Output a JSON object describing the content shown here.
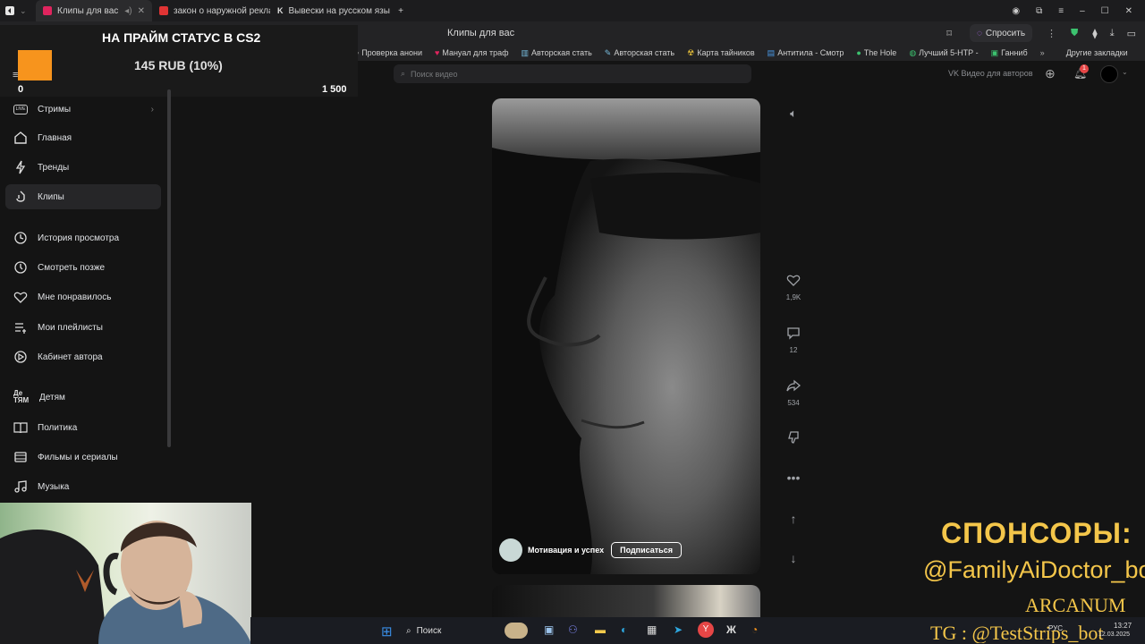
{
  "browser": {
    "tabs": [
      {
        "label": "Клипы для вас",
        "active": true,
        "color": "#e0245e"
      },
      {
        "label": "закон о наружной реклам",
        "active": false,
        "color": "#e03434"
      },
      {
        "label": "Вывески на русском язы",
        "active": false,
        "color": "#cccccc"
      }
    ],
    "address_title": "Клипы для вас",
    "ask_label": "Спросить",
    "bookmarks": [
      "Проверка анони",
      "Мануал для траф",
      "Авторская стать",
      "Авторская стать",
      "Карта тайников",
      "Антитила - Смотр",
      "The Hole",
      "Лучший 5-НТР -",
      "Ганниб"
    ],
    "other_bookmarks": "Другие закладки"
  },
  "promo": {
    "title": "НА ПРАЙМ СТАТУС В CS2",
    "price": "145 RUB (10%)",
    "progress_min": "0",
    "progress_max": "1 500",
    "url_fragment": "vk.com"
  },
  "vk": {
    "search_placeholder": "Поиск видео",
    "for_authors": "VK Видео для авторов",
    "notif_count": "1"
  },
  "sidebar": {
    "items": [
      {
        "label": "Стримы",
        "icon": "live-icon"
      },
      {
        "label": "Главная",
        "icon": "home-icon"
      },
      {
        "label": "Тренды",
        "icon": "trend-icon"
      },
      {
        "label": "Клипы",
        "icon": "clips-icon"
      },
      {
        "label": "История просмотра",
        "icon": "history-icon"
      },
      {
        "label": "Смотреть позже",
        "icon": "clock-icon"
      },
      {
        "label": "Мне понравилось",
        "icon": "heart-icon"
      },
      {
        "label": "Мои плейлисты",
        "icon": "playlist-icon"
      },
      {
        "label": "Кабинет автора",
        "icon": "cabinet-icon"
      },
      {
        "label": "Детям",
        "icon": "kids-icon"
      },
      {
        "label": "Политика",
        "icon": "book-icon"
      },
      {
        "label": "Фильмы и сериалы",
        "icon": "film-icon"
      },
      {
        "label": "Музыка",
        "icon": "music-icon"
      }
    ]
  },
  "clip": {
    "channel": "Мотивация и успех",
    "subscribe": "Подписаться",
    "likes": "1,9K",
    "comments": "12",
    "shares": "534"
  },
  "stream_overlay": {
    "sponsors": "СПОНСОРЫ:",
    "bot": "@FamilyAiDoctor_bot",
    "arcanum": "ARCANUM",
    "tg": "TG : @TestStrips_bot"
  },
  "taskbar": {
    "search": "Поиск",
    "time": "13:27",
    "date": "12.03.2025",
    "lang": "РУС"
  },
  "colors": {
    "accent": "#0077ff",
    "bg": "#141414",
    "promo_orange": "#f7941d"
  }
}
